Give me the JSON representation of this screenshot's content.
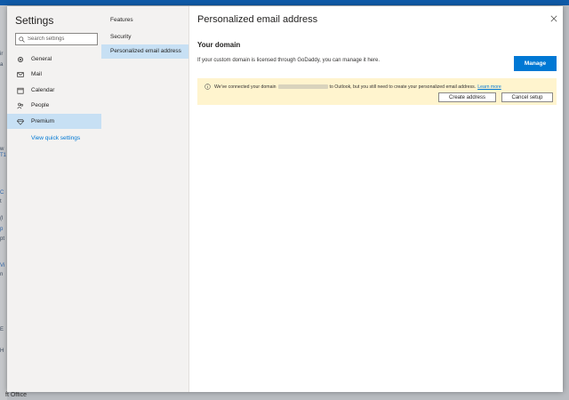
{
  "background": {
    "fragments": [
      "ir",
      "a",
      "w",
      "T1",
      "C",
      "t",
      "(l",
      "p",
      "pt",
      "Vi",
      "n",
      "E",
      "H"
    ],
    "footer": "ft Office"
  },
  "sidebar": {
    "title": "Settings",
    "search_placeholder": "Search settings",
    "items": [
      {
        "label": "General",
        "icon": "gear-icon"
      },
      {
        "label": "Mail",
        "icon": "mail-icon"
      },
      {
        "label": "Calendar",
        "icon": "calendar-icon"
      },
      {
        "label": "People",
        "icon": "people-icon"
      },
      {
        "label": "Premium",
        "icon": "diamond-icon",
        "active": true
      }
    ],
    "quick_settings": "View quick settings"
  },
  "subnav": {
    "items": [
      {
        "label": "Features"
      },
      {
        "label": "Security"
      },
      {
        "label": "Personalized email address",
        "active": true
      }
    ]
  },
  "content": {
    "title": "Personalized email address",
    "section_title": "Your domain",
    "description": "If your custom domain is licensed through GoDaddy, you can manage it here.",
    "manage_label": "Manage",
    "banner": {
      "text_before": "We've connected your domain",
      "text_after": "to Outlook, but you still need to create your personalized email address.",
      "learn_more": "Learn more",
      "create_label": "Create address",
      "cancel_label": "Cancel setup"
    }
  },
  "colors": {
    "accent": "#0078d4",
    "banner_bg": "#fff4ce",
    "active_nav": "#c7e0f4"
  }
}
